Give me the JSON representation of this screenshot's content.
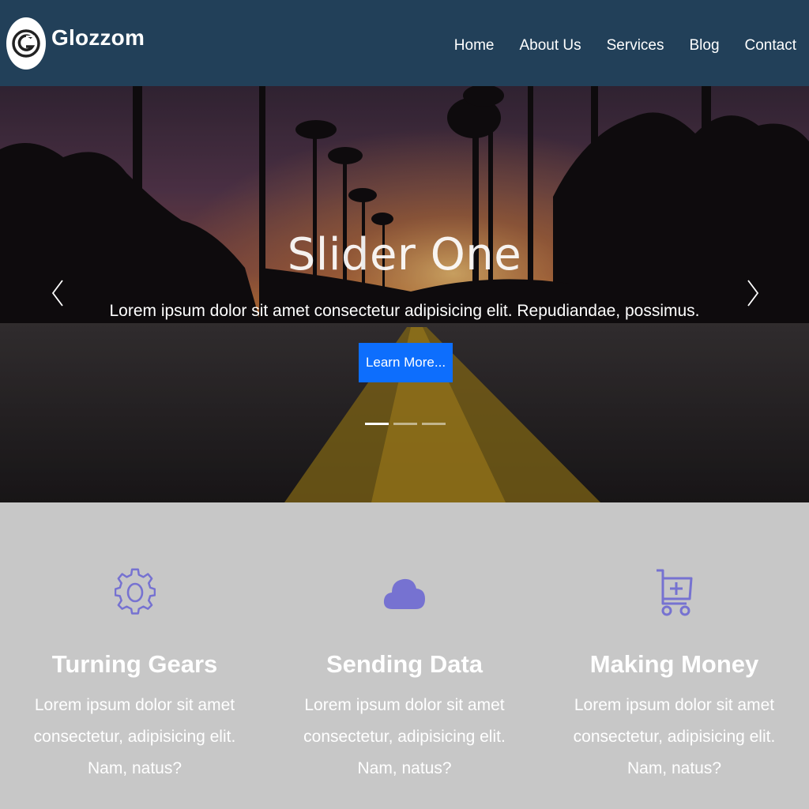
{
  "brand": {
    "name": "Glozzom",
    "logo_icon": "glozzom-logo-icon"
  },
  "nav": {
    "items": [
      "Home",
      "About Us",
      "Services",
      "Blog",
      "Contact"
    ]
  },
  "hero": {
    "title": "Slider One",
    "text": "Lorem ipsum dolor sit amet consectetur adipisicing elit. Repudiandae, possimus.",
    "button_label": "Learn More...",
    "prev_icon": "chevron-left-icon",
    "next_icon": "chevron-right-icon",
    "slide_count": 3,
    "active_slide": 1,
    "button_color": "#0d6efd"
  },
  "features": [
    {
      "icon": "gear-icon",
      "title": "Turning Gears",
      "text": "Lorem ipsum dolor sit amet consectetur, adipisicing elit. Nam, natus?"
    },
    {
      "icon": "cloud-icon",
      "title": "Sending Data",
      "text": "Lorem ipsum dolor sit amet consectetur, adipisicing elit. Nam, natus?"
    },
    {
      "icon": "cart-plus-icon",
      "title": "Making Money",
      "text": "Lorem ipsum dolor sit amet consectetur, adipisicing elit. Nam, natus?"
    }
  ],
  "colors": {
    "navbar": "#224059",
    "features_bg": "#c7c7c7",
    "icon": "#7672d1"
  }
}
